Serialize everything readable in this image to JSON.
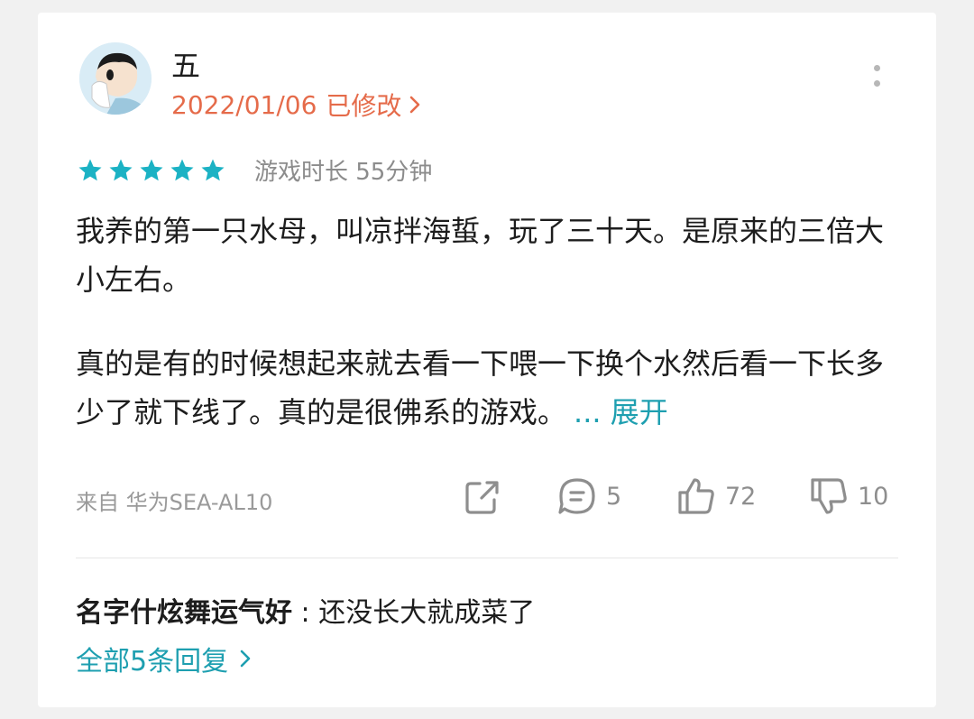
{
  "review": {
    "username": "五",
    "date": "2022/01/06",
    "edited": "已修改",
    "rating": 5,
    "playtime": "游戏时长 55分钟",
    "paragraph1": "我养的第一只水母，叫凉拌海蜇，玩了三十天。是原来的三倍大小左右。",
    "paragraph2": "真的是有的时候想起来就去看一下喂一下换个水然后看一下长多少了就下线了。真的是很佛系的游戏。",
    "expand": "... 展开",
    "device": "来自 华为SEA-AL10"
  },
  "actions": {
    "comments": "5",
    "likes": "72",
    "dislikes": "10"
  },
  "reply": {
    "name": "名字什炫舞运气好",
    "separator": ":",
    "text": "还没长大就成菜了",
    "all_label": "全部5条回复"
  },
  "colors": {
    "accent": "#1e9fb0",
    "date": "#e56b4a",
    "star": "#1bb2c4"
  },
  "icons": [
    "more-vertical-icon",
    "star-icon",
    "share-icon",
    "comment-icon",
    "thumbs-up-icon",
    "thumbs-down-icon",
    "chevron-right-icon"
  ]
}
